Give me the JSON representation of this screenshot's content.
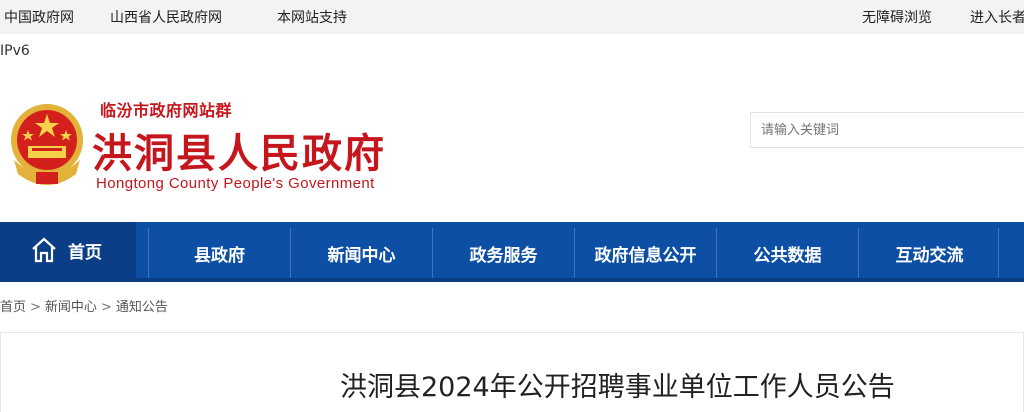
{
  "topbar": {
    "links": [
      "中国政府网",
      "山西省人民政府网",
      "本网站支持"
    ],
    "right_links": [
      "无障碍浏览",
      "进入长者"
    ]
  },
  "ipv6": "IPv6",
  "header": {
    "site_group": "临汾市政府网站群",
    "title": "洪洞县人民政府",
    "subtitle_en": "Hongtong County People's Government",
    "search_placeholder": "请输入关键词",
    "emblem_icon": "national-emblem-icon"
  },
  "nav": {
    "home_label": "首页",
    "home_icon": "home-icon",
    "items": [
      "县政府",
      "新闻中心",
      "政务服务",
      "政府信息公开",
      "公共数据",
      "互动交流"
    ]
  },
  "breadcrumb": [
    "首页",
    "新闻中心",
    "通知公告"
  ],
  "breadcrumb_sep": ">",
  "article": {
    "title": "洪洞县2024年公开招聘事业单位工作人员公告"
  },
  "colors": {
    "brand_red": "#c4161c",
    "nav_blue": "#0d4fa4",
    "nav_home": "#0b3e86"
  }
}
